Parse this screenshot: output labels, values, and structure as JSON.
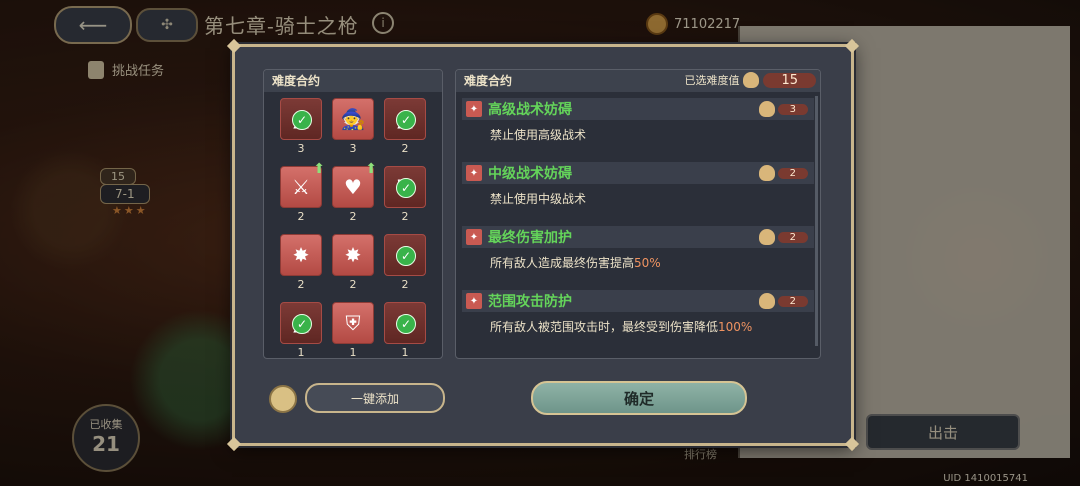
{
  "header": {
    "chapter_title": "第七章-骑士之枪",
    "currency_value": "71102217"
  },
  "map": {
    "task_label": "挑战任务",
    "stage_badge": "15",
    "stage_label": "7-1",
    "stage_stars": "★★★",
    "collected_label": "已收集",
    "collected_count": "21",
    "ranking_label": "排行榜",
    "go_label": "出击",
    "uid": "UID 1410015741"
  },
  "modal": {
    "left_title": "难度合约",
    "right_title": "难度合约",
    "selected_label": "已选难度值",
    "selected_value": "15",
    "icons": [
      {
        "count": "3",
        "glyph": "▲",
        "dark": true,
        "check": true,
        "up": false
      },
      {
        "count": "3",
        "glyph": "🧙",
        "dark": false,
        "check": false,
        "up": false
      },
      {
        "count": "2",
        "glyph": "▲",
        "dark": true,
        "check": true,
        "up": false
      },
      {
        "count": "2",
        "glyph": "⚔",
        "dark": false,
        "check": false,
        "up": true
      },
      {
        "count": "2",
        "glyph": "♥",
        "dark": false,
        "check": false,
        "up": true
      },
      {
        "count": "2",
        "glyph": "⛨",
        "dark": true,
        "check": true,
        "up": false
      },
      {
        "count": "2",
        "glyph": "✸",
        "dark": false,
        "check": false,
        "up": false
      },
      {
        "count": "2",
        "glyph": "✸",
        "dark": false,
        "check": false,
        "up": false
      },
      {
        "count": "2",
        "glyph": "✸",
        "dark": true,
        "check": true,
        "up": false
      },
      {
        "count": "1",
        "glyph": "▲",
        "dark": true,
        "check": true,
        "up": false
      },
      {
        "count": "1",
        "glyph": "⛨",
        "dark": false,
        "check": false,
        "up": false
      },
      {
        "count": "1",
        "glyph": "♥",
        "dark": true,
        "check": true,
        "up": false
      }
    ],
    "clauses": [
      {
        "name": "高级战术妨碍",
        "cost": "3",
        "desc_pre": "禁止使用高级战术",
        "desc_hl": "",
        "desc_post": ""
      },
      {
        "name": "中级战术妨碍",
        "cost": "2",
        "desc_pre": "禁止使用中级战术",
        "desc_hl": "",
        "desc_post": ""
      },
      {
        "name": "最终伤害加护",
        "cost": "2",
        "desc_pre": "所有敌人造成最终伤害提高",
        "desc_hl": "50%",
        "desc_post": ""
      },
      {
        "name": "范围攻击防护",
        "cost": "2",
        "desc_pre": "所有敌人被范围攻击时，最终受到伤害降低",
        "desc_hl": "100%",
        "desc_post": ""
      }
    ],
    "add_button": "一键添加",
    "confirm_button": "确定"
  },
  "colors": {
    "accent_gold": "#c8b58c",
    "clause_green": "#64d45a",
    "highlight_orange": "#ef9361",
    "tile_red": "#c55a53"
  }
}
